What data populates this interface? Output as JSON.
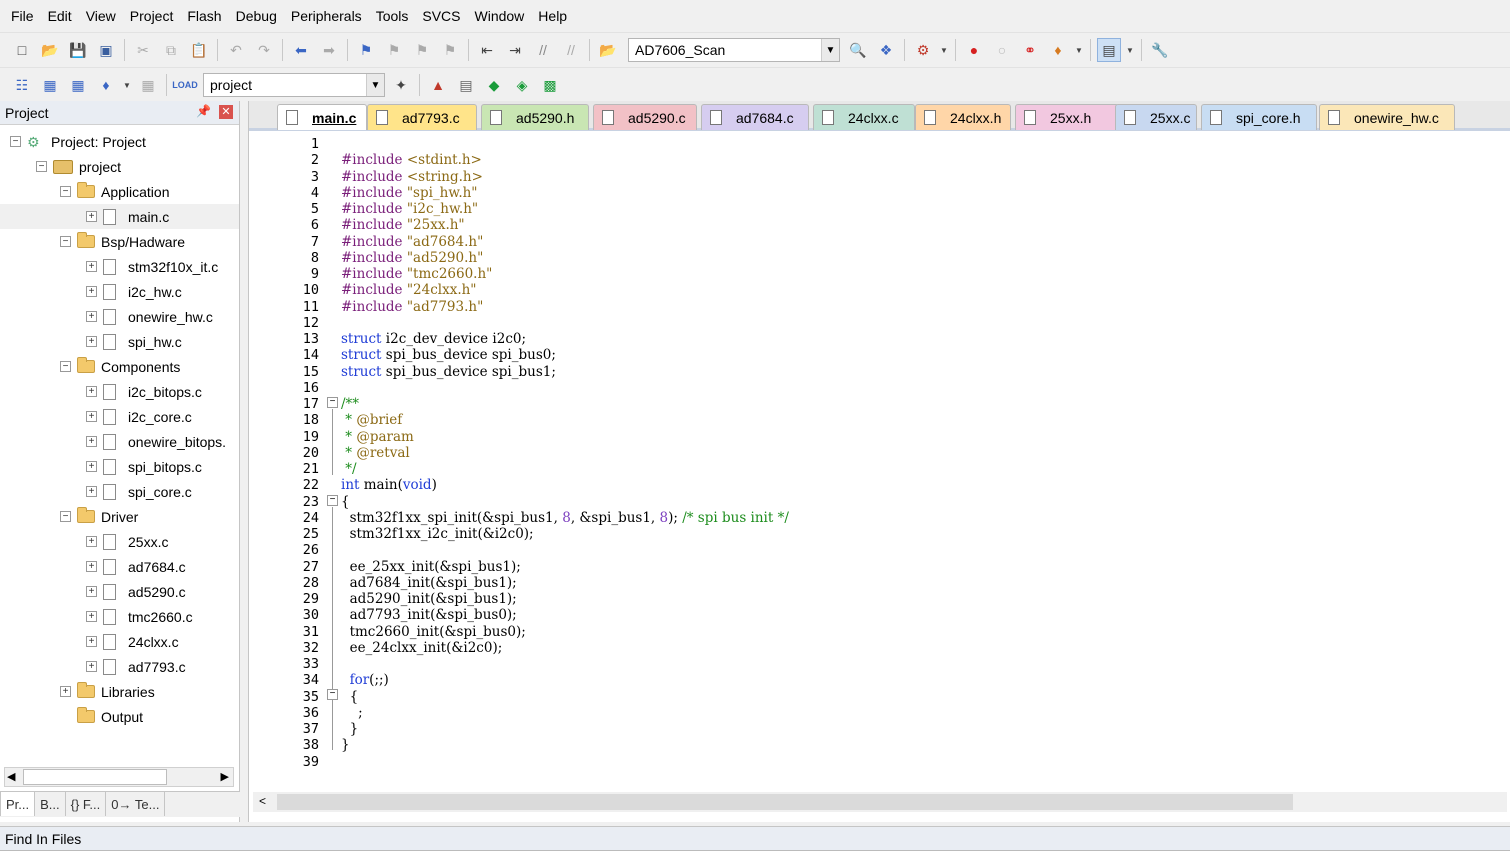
{
  "menu": [
    "File",
    "Edit",
    "View",
    "Project",
    "Flash",
    "Debug",
    "Peripherals",
    "Tools",
    "SVCS",
    "Window",
    "Help"
  ],
  "toolbar": {
    "target_select": "AD7606_Scan",
    "group_select": "project"
  },
  "project_panel": {
    "title": "Project",
    "tree": [
      {
        "label": "Project: Project",
        "level": 0,
        "type": "root"
      },
      {
        "label": "project",
        "level": 1,
        "type": "target"
      },
      {
        "label": "Application",
        "level": 2,
        "type": "folder"
      },
      {
        "label": "main.c",
        "level": 3,
        "type": "file",
        "selected": true
      },
      {
        "label": "Bsp/Hadware",
        "level": 2,
        "type": "folder"
      },
      {
        "label": "stm32f10x_it.c",
        "level": 3,
        "type": "file"
      },
      {
        "label": "i2c_hw.c",
        "level": 3,
        "type": "file"
      },
      {
        "label": "onewire_hw.c",
        "level": 3,
        "type": "file"
      },
      {
        "label": "spi_hw.c",
        "level": 3,
        "type": "file"
      },
      {
        "label": "Components",
        "level": 2,
        "type": "folder"
      },
      {
        "label": "i2c_bitops.c",
        "level": 3,
        "type": "file"
      },
      {
        "label": "i2c_core.c",
        "level": 3,
        "type": "file"
      },
      {
        "label": "onewire_bitops.",
        "level": 3,
        "type": "file"
      },
      {
        "label": "spi_bitops.c",
        "level": 3,
        "type": "file"
      },
      {
        "label": "spi_core.c",
        "level": 3,
        "type": "file"
      },
      {
        "label": "Driver",
        "level": 2,
        "type": "folder"
      },
      {
        "label": "25xx.c",
        "level": 3,
        "type": "file"
      },
      {
        "label": "ad7684.c",
        "level": 3,
        "type": "file"
      },
      {
        "label": "ad5290.c",
        "level": 3,
        "type": "file"
      },
      {
        "label": "tmc2660.c",
        "level": 3,
        "type": "file"
      },
      {
        "label": "24clxx.c",
        "level": 3,
        "type": "file"
      },
      {
        "label": "ad7793.c",
        "level": 3,
        "type": "file"
      },
      {
        "label": "Libraries",
        "level": 2,
        "type": "folder-collapsed"
      },
      {
        "label": "Output",
        "level": 2,
        "type": "folder-empty"
      }
    ],
    "bottom_tabs": [
      "Pr...",
      "B...",
      "{} F...",
      "0→ Te..."
    ]
  },
  "editor": {
    "tabs": [
      {
        "label": "main.c",
        "color": "#ffffff",
        "active": true
      },
      {
        "label": "ad7793.c",
        "color": "#ffe48a"
      },
      {
        "label": "ad5290.h",
        "color": "#c9e6b3"
      },
      {
        "label": "ad5290.c",
        "color": "#f2c1c6"
      },
      {
        "label": "ad7684.c",
        "color": "#d6cdf0"
      },
      {
        "label": "24clxx.c",
        "color": "#bfe0d4"
      },
      {
        "label": "24clxx.h",
        "color": "#ffd6a8"
      },
      {
        "label": "25xx.h",
        "color": "#f2c8e0"
      },
      {
        "label": "25xx.c",
        "color": "#c8d8f0"
      },
      {
        "label": "spi_core.h",
        "color": "#c8ddf3"
      },
      {
        "label": "onewire_hw.c",
        "color": "#fbe7b8"
      }
    ],
    "line_count": 39,
    "code_lines": [
      [],
      [
        [
          "pp",
          "#include "
        ],
        [
          "str",
          "<stdint.h>"
        ]
      ],
      [
        [
          "pp",
          "#include "
        ],
        [
          "str",
          "<string.h>"
        ]
      ],
      [
        [
          "pp",
          "#include "
        ],
        [
          "str",
          "\"spi_hw.h\""
        ]
      ],
      [
        [
          "pp",
          "#include "
        ],
        [
          "str",
          "\"i2c_hw.h\""
        ]
      ],
      [
        [
          "pp",
          "#include "
        ],
        [
          "str",
          "\"25xx.h\""
        ]
      ],
      [
        [
          "pp",
          "#include "
        ],
        [
          "str",
          "\"ad7684.h\""
        ]
      ],
      [
        [
          "pp",
          "#include "
        ],
        [
          "str",
          "\"ad5290.h\""
        ]
      ],
      [
        [
          "pp",
          "#include "
        ],
        [
          "str",
          "\"tmc2660.h\""
        ]
      ],
      [
        [
          "pp",
          "#include "
        ],
        [
          "str",
          "\"24clxx.h\""
        ]
      ],
      [
        [
          "pp",
          "#include "
        ],
        [
          "str",
          "\"ad7793.h\""
        ]
      ],
      [],
      [
        [
          "kw",
          "struct"
        ],
        [
          "",
          " i2c_dev_device i2c0;"
        ]
      ],
      [
        [
          "kw",
          "struct"
        ],
        [
          "",
          " spi_bus_device spi_bus0;"
        ]
      ],
      [
        [
          "kw",
          "struct"
        ],
        [
          "",
          " spi_bus_device spi_bus1;"
        ]
      ],
      [],
      [
        [
          "cm",
          "/**"
        ]
      ],
      [
        [
          "cm",
          " * "
        ],
        [
          "str",
          "@brief"
        ]
      ],
      [
        [
          "cm",
          " * "
        ],
        [
          "str",
          "@param"
        ]
      ],
      [
        [
          "cm",
          " * "
        ],
        [
          "str",
          "@retval"
        ]
      ],
      [
        [
          "cm",
          " */"
        ]
      ],
      [
        [
          "kw",
          "int"
        ],
        [
          "",
          " main("
        ],
        [
          "kw",
          "void"
        ],
        [
          "",
          ")"
        ]
      ],
      [
        [
          "",
          "{"
        ]
      ],
      [
        [
          "",
          "  stm32f1xx_spi_init(&spi_bus1, "
        ],
        [
          "num",
          "8"
        ],
        [
          "",
          ", &spi_bus1, "
        ],
        [
          "num",
          "8"
        ],
        [
          "",
          "); "
        ],
        [
          "cm",
          "/* spi bus init */"
        ]
      ],
      [
        [
          "",
          "  stm32f1xx_i2c_init(&i2c0);"
        ]
      ],
      [],
      [
        [
          "",
          "  ee_25xx_init(&spi_bus1);"
        ]
      ],
      [
        [
          "",
          "  ad7684_init(&spi_bus1);"
        ]
      ],
      [
        [
          "",
          "  ad5290_init(&spi_bus1);"
        ]
      ],
      [
        [
          "",
          "  ad7793_init(&spi_bus0);"
        ]
      ],
      [
        [
          "",
          "  tmc2660_init(&spi_bus0);"
        ]
      ],
      [
        [
          "",
          "  ee_24clxx_init(&i2c0);"
        ]
      ],
      [],
      [
        [
          "kw",
          "  for"
        ],
        [
          "",
          "(;;)"
        ]
      ],
      [
        [
          "",
          "  {"
        ]
      ],
      [
        [
          "",
          "    ;"
        ]
      ],
      [
        [
          "",
          "  }"
        ]
      ],
      [
        [
          "",
          "}"
        ]
      ],
      []
    ]
  },
  "find_panel": {
    "title": "Find In Files"
  }
}
